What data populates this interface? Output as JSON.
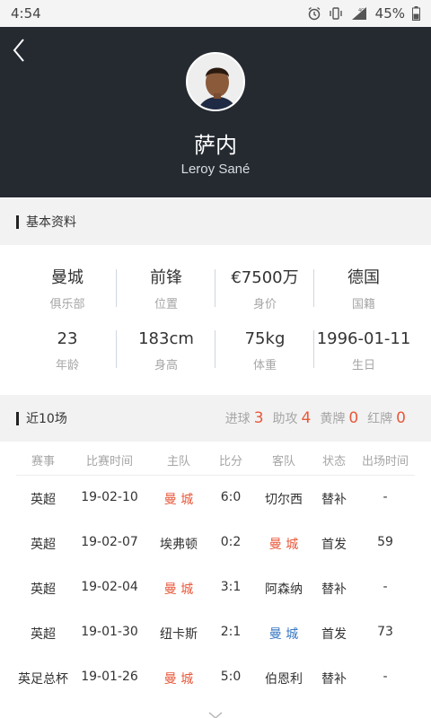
{
  "status_bar": {
    "time": "4:54",
    "battery": "45%",
    "network": "4G"
  },
  "player": {
    "name_cn": "萨内",
    "name_en": "Leroy Sané"
  },
  "basic_info": {
    "title": "基本资料",
    "row1": [
      {
        "value": "曼城",
        "label": "俱乐部"
      },
      {
        "value": "前锋",
        "label": "位置"
      },
      {
        "value": "€7500万",
        "label": "身价"
      },
      {
        "value": "德国",
        "label": "国籍"
      }
    ],
    "row2": [
      {
        "value": "23",
        "label": "年龄"
      },
      {
        "value": "183cm",
        "label": "身高"
      },
      {
        "value": "75kg",
        "label": "体重"
      },
      {
        "value": "1996-01-11",
        "label": "生日"
      }
    ]
  },
  "recent": {
    "title": "近10场",
    "stats": [
      {
        "label": "进球",
        "value": "3"
      },
      {
        "label": "助攻",
        "value": "4"
      },
      {
        "label": "黄牌",
        "value": "0"
      },
      {
        "label": "红牌",
        "value": "0"
      }
    ],
    "headers": [
      "赛事",
      "比赛时间",
      "主队",
      "比分",
      "客队",
      "状态",
      "出场时间"
    ],
    "matches": [
      {
        "comp": "英超",
        "date": "19-02-10",
        "home": "曼 城",
        "score": "6:0",
        "away": "切尔西",
        "status": "替补",
        "minutes": "-",
        "hl": "home",
        "hl_color": "red"
      },
      {
        "comp": "英超",
        "date": "19-02-07",
        "home": "埃弗顿",
        "score": "0:2",
        "away": "曼 城",
        "status": "首发",
        "minutes": "59",
        "hl": "away",
        "hl_color": "red"
      },
      {
        "comp": "英超",
        "date": "19-02-04",
        "home": "曼 城",
        "score": "3:1",
        "away": "阿森纳",
        "status": "替补",
        "minutes": "-",
        "hl": "home",
        "hl_color": "red"
      },
      {
        "comp": "英超",
        "date": "19-01-30",
        "home": "纽卡斯",
        "score": "2:1",
        "away": "曼 城",
        "status": "首发",
        "minutes": "73",
        "hl": "away",
        "hl_color": "blue"
      },
      {
        "comp": "英足总杯",
        "date": "19-01-26",
        "home": "曼 城",
        "score": "5:0",
        "away": "伯恩利",
        "status": "替补",
        "minutes": "-",
        "hl": "home",
        "hl_color": "red"
      }
    ]
  },
  "colors": {
    "header_bg": "#252a31",
    "accent_red": "#e8593b",
    "accent_blue": "#3a78c3"
  }
}
